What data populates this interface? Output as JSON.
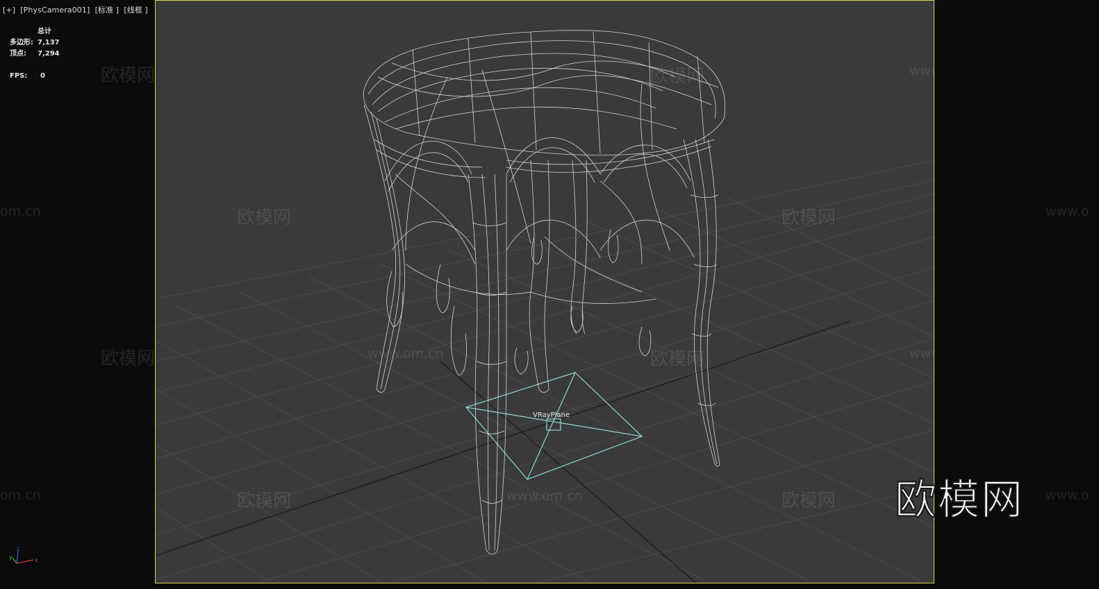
{
  "viewport": {
    "label": "[+]  [PhysCamera001]  [标准 ]  [线框 ]"
  },
  "stats": {
    "header": "总计",
    "polygons_label": "多边形:",
    "polygons_value": "7,137",
    "vertices_label": "顶点:",
    "vertices_value": "7,294",
    "fps_label": "FPS:",
    "fps_value": "0"
  },
  "scene": {
    "object_label": "VRayPlane",
    "wireframe_color": "#e6e6e6",
    "grid_color": "#4a4a4a",
    "plane_color": "#8fd6d6",
    "selection_border_color": "#d8d84a",
    "viewport_bg": "#3a3a3a"
  },
  "watermarks": {
    "cn": "欧模网",
    "url": "www.om.cn",
    "url_cut": "om.cn",
    "url_cut_right": "www.o"
  },
  "logo": {
    "text": "欧模网"
  },
  "gizmo": {
    "x": "x",
    "y": "y",
    "z": "z"
  }
}
